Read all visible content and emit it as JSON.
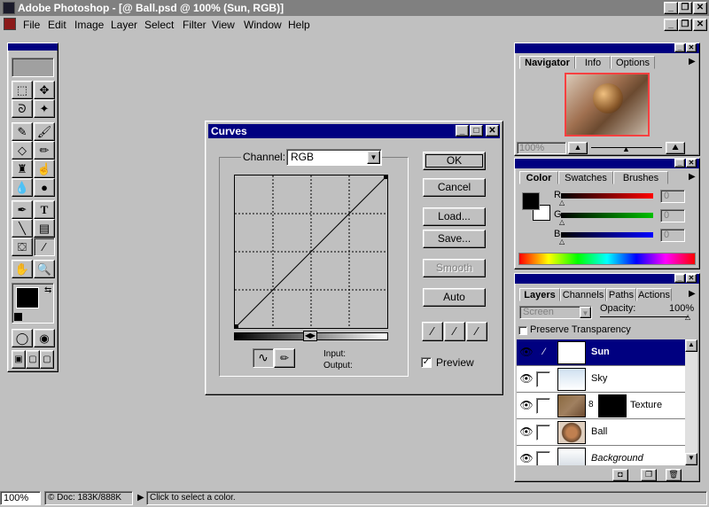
{
  "app": {
    "title": "Adobe Photoshop - [@ Ball.psd @ 100% (Sun, RGB)]"
  },
  "menu": [
    "File",
    "Edit",
    "Image",
    "Layer",
    "Select",
    "Filter",
    "View",
    "Window",
    "Help"
  ],
  "navigator": {
    "tabs": [
      "Navigator",
      "Info",
      "Options"
    ],
    "zoom": "100%"
  },
  "color": {
    "tabs": [
      "Color",
      "Swatches",
      "Brushes"
    ],
    "channels": [
      {
        "label": "R",
        "value": "0",
        "color": "#ff0000"
      },
      {
        "label": "G",
        "value": "0",
        "color": "#00c000"
      },
      {
        "label": "B",
        "value": "0",
        "color": "#0000ff"
      }
    ]
  },
  "layers": {
    "tabs": [
      "Layers",
      "Channels",
      "Paths",
      "Actions"
    ],
    "blend_mode": "Screen",
    "opacity_label": "Opacity:",
    "opacity": "100%",
    "preserve_label": "Preserve Transparency",
    "items": [
      {
        "name": "Sun",
        "selected": true
      },
      {
        "name": "Sky"
      },
      {
        "name": "Texture"
      },
      {
        "name": "Ball"
      },
      {
        "name": "Background"
      }
    ]
  },
  "curves": {
    "title": "Curves",
    "channel_label": "Channel:",
    "channel": "RGB",
    "buttons": {
      "ok": "OK",
      "cancel": "Cancel",
      "load": "Load...",
      "save": "Save...",
      "smooth": "Smooth",
      "auto": "Auto"
    },
    "input_label": "Input:",
    "output_label": "Output:",
    "preview_label": "Preview",
    "preview_checked": true
  },
  "status": {
    "zoom": "100%",
    "doc": "Doc: 183K/888K",
    "message": "Click to select a color."
  }
}
